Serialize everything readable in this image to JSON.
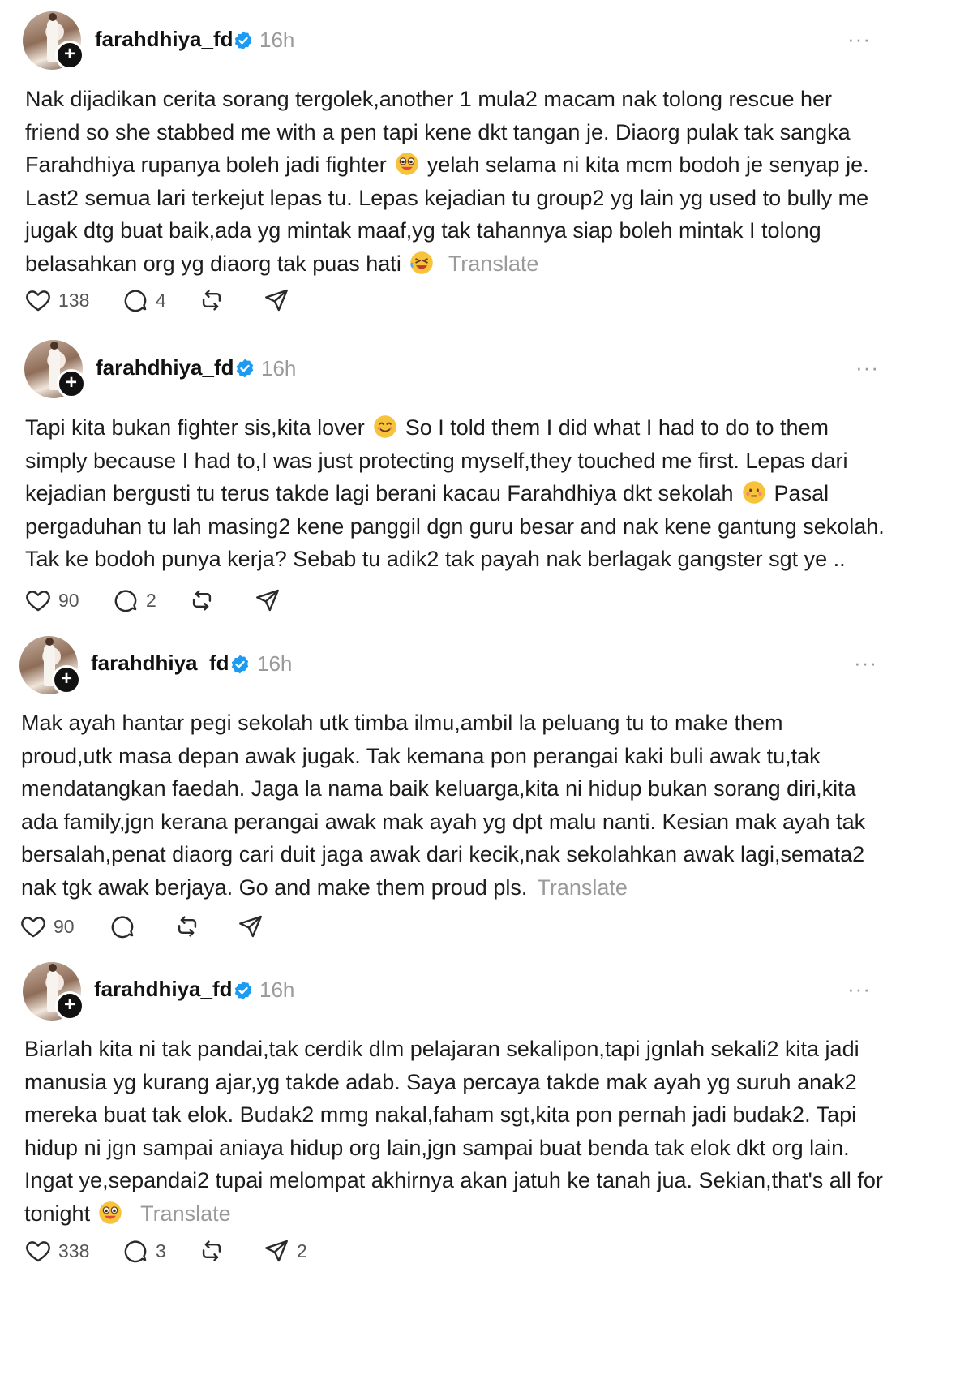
{
  "posts": [
    {
      "username": "farahdhiya_fd",
      "time": "16h",
      "more": "···",
      "lines": [
        "Nak dijadikan cerita sorang tergolek,another 1 mula2 macam nak tolong rescue her",
        "friend so she stabbed me with a pen tapi kene dkt tangan je. Diaorg pulak tak sangka",
        "Farahdhiya rupanya boleh jadi fighter",
        "yelah selama ni kita mcm bodoh je senyap je.",
        "Last2 semua lari terkejut lepas tu. Lepas kejadian tu group2 yg lain yg used to bully me",
        "jugak dtg buat baik,ada yg mintak maaf,yg tak tahannya siap boleh mintak I tolong",
        "belasahkan org yg diaorg tak puas hati"
      ],
      "translate": "Translate",
      "likes": "138",
      "comments": "4",
      "shares": ""
    },
    {
      "username": "farahdhiya_fd",
      "time": "16h",
      "more": "···",
      "lines": [
        "Tapi kita bukan fighter sis,kita lover",
        "So I told them I did what I had to do to them",
        "simply because I had to,I was just protecting myself,they touched me first. Lepas dari",
        "kejadian bergusti tu terus takde lagi berani kacau Farahdhiya dkt sekolah",
        "Pasal",
        "pergaduhan tu lah masing2 kene panggil dgn guru besar and nak kene gantung sekolah.",
        "Tak ke bodoh punya kerja? Sebab tu adik2 tak payah nak berlagak gangster sgt ye .."
      ],
      "likes": "90",
      "comments": "2",
      "shares": ""
    },
    {
      "username": "farahdhiya_fd",
      "time": "16h",
      "more": "···",
      "lines": [
        "Mak ayah hantar pegi sekolah utk timba ilmu,ambil la peluang tu to make them",
        "proud,utk masa depan awak jugak. Tak kemana pon perangai kaki buli awak tu,tak",
        "mendatangkan faedah. Jaga la nama baik keluarga,kita ni hidup bukan sorang diri,kita",
        "ada family,jgn kerana perangai awak mak ayah yg dpt malu nanti. Kesian mak ayah tak",
        "bersalah,penat diaorg cari duit jaga awak dari kecik,nak sekolahkan awak lagi,semata2",
        "nak tgk awak berjaya. Go and make them proud pls."
      ],
      "translate": "Translate",
      "likes": "90",
      "comments": "",
      "shares": ""
    },
    {
      "username": "farahdhiya_fd",
      "time": "16h",
      "more": "···",
      "lines": [
        "Biarlah kita ni tak pandai,tak cerdik dlm pelajaran sekalipon,tapi jgnlah sekali2 kita jadi",
        "manusia yg kurang ajar,yg takde adab. Saya percaya takde mak ayah yg suruh anak2",
        "mereka buat tak elok. Budak2 mmg nakal,faham sgt,kita pon pernah jadi budak2. Tapi",
        "hidup ni jgn sampai aniaya hidup org lain,jgn sampai buat benda tak elok dkt org lain.",
        "Ingat ye,sepandai2 tupai melompat akhirnya akan jatuh ke tanah jua. Sekian,that's all for",
        "tonight"
      ],
      "translate": "Translate",
      "likes": "338",
      "comments": "3",
      "shares": "2"
    }
  ]
}
